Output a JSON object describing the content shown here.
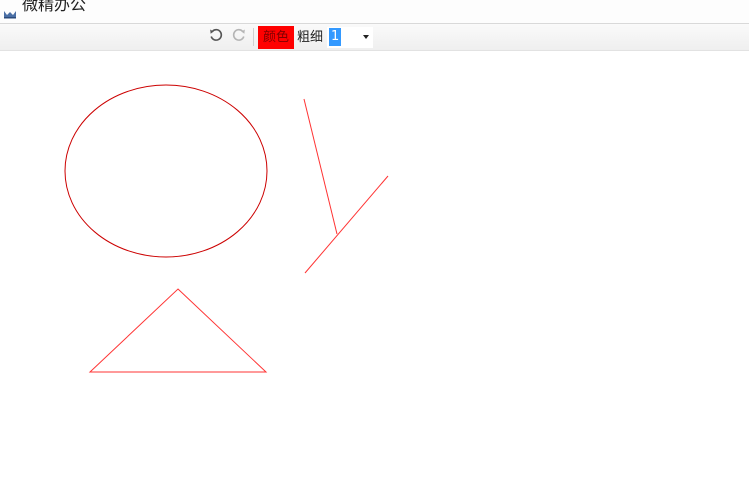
{
  "window": {
    "title": "微精办公"
  },
  "toolbar": {
    "undo_icon": "undo-icon",
    "redo_icon": "redo-icon",
    "color_label": "颜色",
    "color_value": "#ff0000",
    "thickness_label": "粗细",
    "thickness_value": "1"
  },
  "canvas": {
    "stroke_color": "#ff0000",
    "shapes": [
      "ellipse",
      "line",
      "line",
      "triangle"
    ]
  }
}
